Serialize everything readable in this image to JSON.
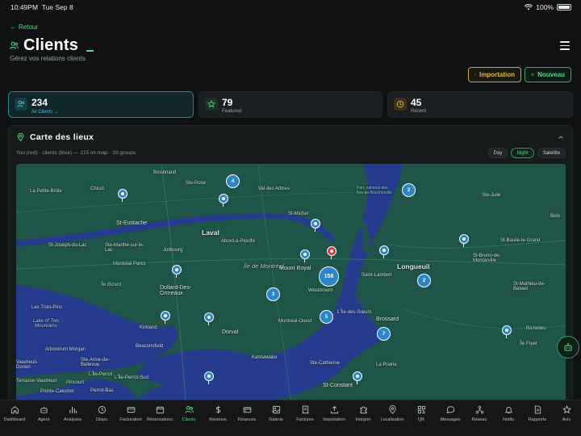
{
  "status": {
    "time": "10:49PM",
    "date": "Tue Sep 8",
    "battery": "100%"
  },
  "header": {
    "back_label": "Retour",
    "title": "Clients",
    "subtitle": "Gérez vos relations clients",
    "import_label": "Importation",
    "new_label": "Nouveau"
  },
  "stats": [
    {
      "value": "234",
      "label": "All Clients",
      "icon": "users-icon"
    },
    {
      "value": "79",
      "label": "Featured",
      "icon": "star-icon"
    },
    {
      "value": "45",
      "label": "Recent",
      "icon": "clock-icon"
    }
  ],
  "map_panel": {
    "title": "Carte des lieux",
    "info": "You (red) · clients (blue) — 215 on map · 33 groups",
    "modes": [
      "Day",
      "Night",
      "Satellite"
    ],
    "active_mode": "Night",
    "places": {
      "boisbriand": "Boisbriand",
      "ste_rose": "Ste-Rose",
      "val_des_arbres": "Val des Arbres",
      "parc": "Parc national des Îles-de-Boucherville",
      "petite_brule": "La Petite-Brûle",
      "chicot": "Chicot",
      "ste_julie": "Ste-Julie",
      "beloeil": "Belo",
      "st_eustache": "St-Eustache",
      "st_michel": "St-Michel",
      "laval": "Laval",
      "abord_a_plouffe": "Abord-à-Plouffe",
      "st_joseph": "St-Joseph-du-Lac",
      "ste_marthe": "Ste-Marthe-sur-le-Lac",
      "jolibourg": "Jolibourg",
      "ile_de_montreal": "Île de Montréal",
      "mount_royal": "Mount Royal",
      "longueuil": "Longueuil",
      "st_bruno": "St-Bruno-de-Montarville",
      "montreal_parcs": "Montréal Parcs",
      "ile_bizard": "Île Bizard",
      "dollard": "Dollard-Des-Ormeaux",
      "westmount": "Westmount",
      "saint_lambert": "Saint-Lambert",
      "st_mathieu": "St-Mathieu-de-Beloeil",
      "cedres": "Les Trois-Pins",
      "lake_two_mountains": "Lake of Two Mountains",
      "kirkland": "Kirkland",
      "dorval": "Dorval",
      "montreal_ouest": "Montréal-Ouest",
      "ile_des_soeurs": "L'Île-des-Sœurs",
      "brossard": "Brossard",
      "richelieu": "Richelieu",
      "arboretum": "Arboretum Morgan",
      "beaconsfield": "Beaconsfield",
      "ste_anne": "Ste-Anne-de-Bellevue",
      "kahnawake": "Kahnawake",
      "ste_catherine": "Ste-Catherine",
      "la_prairie": "La Prairie",
      "ile_perrot": "L'Île-Perrot",
      "vaudreuil": "Vaudreuil-Dorion",
      "pointe_calumet": "Pointe-Calumet",
      "st_constant": "St-Constant",
      "perrot_sud": "L'Île-Perrot-Sud",
      "terrasse": "Terrasse-Vaudreuil",
      "pincourt": "Pincourt",
      "perrot_bas": "Perrot-Bas",
      "fryer": "Île Fryer",
      "st_basile": "St-Basile-le-Grand"
    },
    "clusters": [
      "4",
      "2",
      "158",
      "3",
      "5",
      "2",
      "7"
    ]
  },
  "nav": [
    {
      "label": "Dashboard",
      "icon": "home-icon"
    },
    {
      "label": "Agent",
      "icon": "bot-icon"
    },
    {
      "label": "Analyses",
      "icon": "bar-chart-icon"
    },
    {
      "label": "Dispo",
      "icon": "clock-icon"
    },
    {
      "label": "Facturation",
      "icon": "card-icon"
    },
    {
      "label": "Réservations",
      "icon": "calendar-icon"
    },
    {
      "label": "Clients",
      "icon": "users-icon"
    },
    {
      "label": "Revenus",
      "icon": "dollar-icon"
    },
    {
      "label": "Finances",
      "icon": "wallet-icon"
    },
    {
      "label": "Galerie",
      "icon": "image-icon"
    },
    {
      "label": "Factures",
      "icon": "receipt-icon"
    },
    {
      "label": "Importation",
      "icon": "upload-icon"
    },
    {
      "label": "Intégrer",
      "icon": "puzzle-icon"
    },
    {
      "label": "Localisation",
      "icon": "map-pin-icon"
    },
    {
      "label": "QR",
      "icon": "qr-icon"
    },
    {
      "label": "Messages",
      "icon": "message-icon"
    },
    {
      "label": "Réseau",
      "icon": "network-icon"
    },
    {
      "label": "Notifs",
      "icon": "bell-icon"
    },
    {
      "label": "Rapports",
      "icon": "file-icon"
    },
    {
      "label": "Avis",
      "icon": "star-icon"
    }
  ],
  "active_nav": "Clients",
  "colors": {
    "accent": "#4ade80",
    "import": "#e5b63a",
    "cluster": "#2b86c9",
    "you": "#d63b3b",
    "water": "#243a8c",
    "land": "#1f5a4d"
  }
}
